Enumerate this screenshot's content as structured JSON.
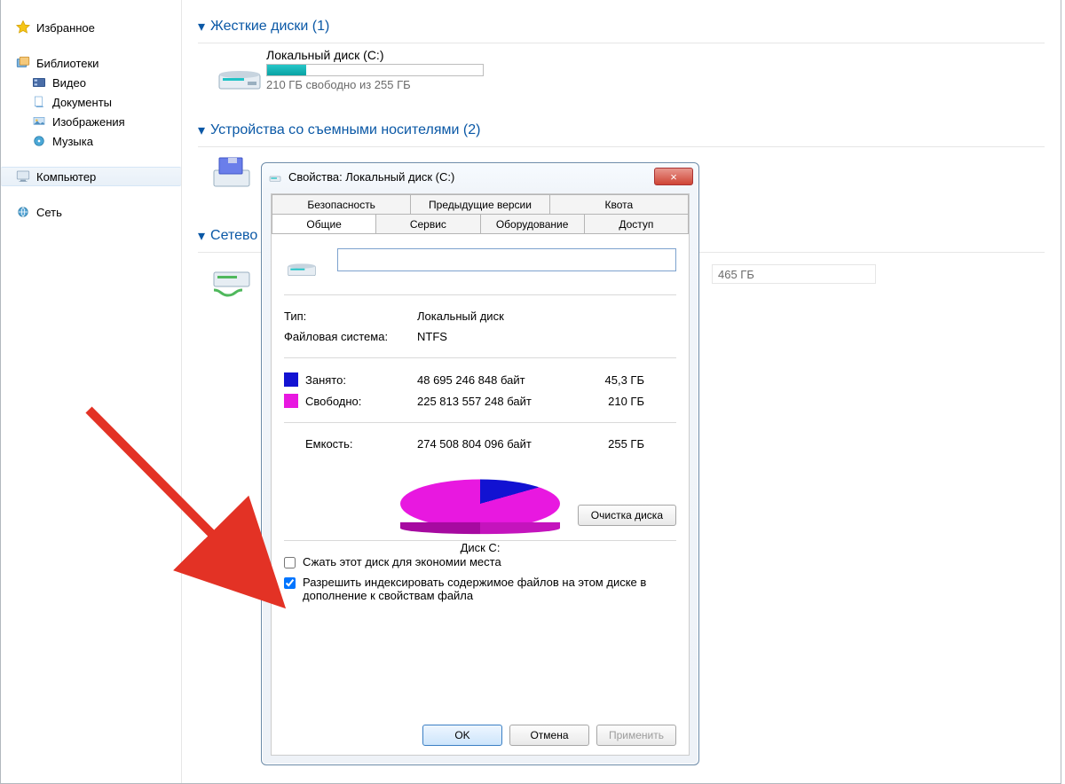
{
  "sidebar": {
    "fav": {
      "label": "Избранное"
    },
    "lib": {
      "label": "Библиотеки",
      "video": "Видео",
      "docs": "Документы",
      "images": "Изображения",
      "music": "Музыка"
    },
    "computer": "Компьютер",
    "network": "Сеть"
  },
  "sections": {
    "hdd": "Жесткие диски (1)",
    "removable": "Устройства со съемными носителями (2)",
    "netloc": "Сетево"
  },
  "drive_c": {
    "name": "Локальный диск (C:)",
    "free_text": "210 ГБ свободно из 255 ГБ",
    "bar_pct": 18
  },
  "ghost_size": "465 ГБ",
  "dialog": {
    "title": "Свойства: Локальный диск (C:)",
    "close_icon": "×",
    "tabs": {
      "security": "Безопасность",
      "previous": "Предыдущие версии",
      "quota": "Квота",
      "general": "Общие",
      "service": "Сервис",
      "hardware": "Оборудование",
      "access": "Доступ"
    },
    "name_value": "",
    "type_k": "Тип:",
    "type_v": "Локальный диск",
    "fs_k": "Файловая система:",
    "fs_v": "NTFS",
    "used_k": "Занято:",
    "used_bytes": "48 695 246 848 байт",
    "used_gb": "45,3 ГБ",
    "free_k": "Свободно:",
    "free_bytes": "225 813 557 248 байт",
    "free_gb": "210 ГБ",
    "cap_k": "Емкость:",
    "cap_bytes": "274 508 804 096 байт",
    "cap_gb": "255 ГБ",
    "disk_label": "Диск C:",
    "cleanup": "Очистка диска",
    "chk_compress": "Сжать этот диск для экономии места",
    "chk_index": "Разрешить индексировать содержимое файлов на этом диске в дополнение к свойствам файла",
    "ok": "OK",
    "cancel": "Отмена",
    "apply": "Применить"
  },
  "chart_data": {
    "type": "pie",
    "title": "Диск C:",
    "series": [
      {
        "name": "Занято",
        "value": 48695246848,
        "display": "45,3 ГБ",
        "color": "#1212d2"
      },
      {
        "name": "Свободно",
        "value": 225813557248,
        "display": "210 ГБ",
        "color": "#e818e0"
      }
    ],
    "total": {
      "name": "Емкость",
      "value": 274508804096,
      "display": "255 ГБ"
    }
  }
}
